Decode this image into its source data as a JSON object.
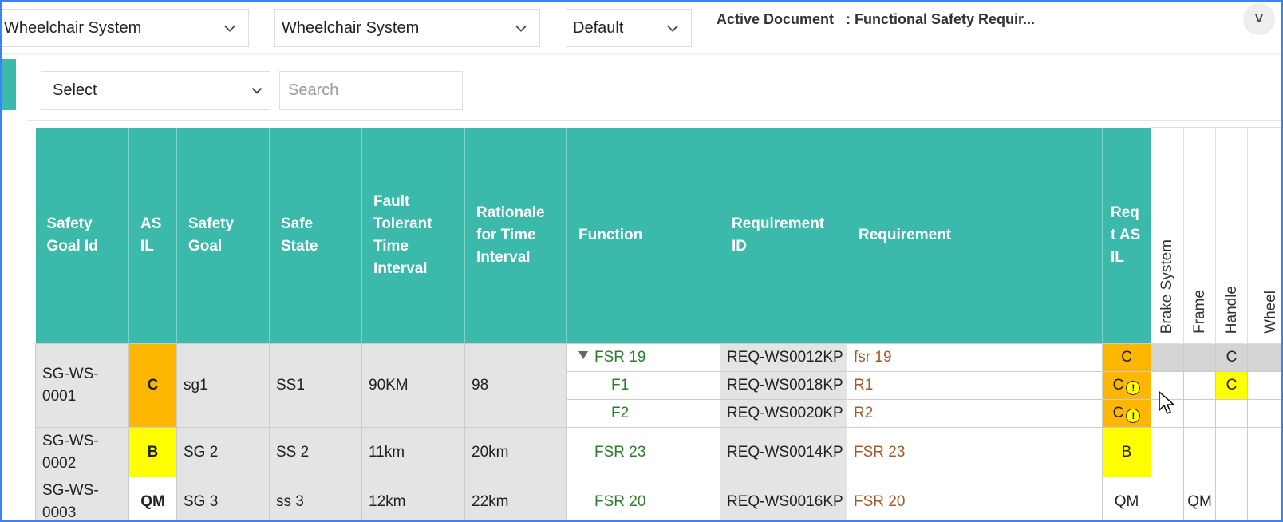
{
  "topbar": {
    "project_select_1": "Wheelchair System",
    "project_select_2": "Wheelchair System",
    "config_select": "Default",
    "active_label": "Active Document",
    "active_value": ": Functional Safety Requir...",
    "avatar_text": "V"
  },
  "filters": {
    "select_value": "Select",
    "search_placeholder": "Search"
  },
  "table": {
    "headers": {
      "sg_id": "Safety Goal Id",
      "asil": "ASIL",
      "safety_goal": "Safety Goal",
      "safe_state": "Safe State",
      "ftti": "Fault Tolerant Time Interval",
      "rationale": "Rationale for Time Interval",
      "function": "Function",
      "req_id": "Requirement ID",
      "requirement": "Requirement",
      "reqt_asil": "Reqt ASIL",
      "brake": "Brake System",
      "frame": "Frame",
      "handle": "Handle",
      "wheel": "Wheel"
    },
    "goals": [
      {
        "id": "SG-WS-0001",
        "asil": "C",
        "goal": "sg1",
        "state": "SS1",
        "ftti": "90KM",
        "rationale": "98",
        "rows": [
          {
            "function": "FSR 19",
            "req_id": "REQ-WS0012KP",
            "requirement": "fsr 19",
            "reqt_asil": "C",
            "handle": "C"
          },
          {
            "function": "F1",
            "req_id": "REQ-WS0018KP",
            "requirement": "R1",
            "reqt_asil": "C",
            "handle": "C"
          },
          {
            "function": "F2",
            "req_id": "REQ-WS0020KP",
            "requirement": "R2",
            "reqt_asil": "C"
          }
        ]
      },
      {
        "id": "SG-WS-0002",
        "asil": "B",
        "goal": "SG 2",
        "state": "SS 2",
        "ftti": "11km",
        "rationale": "20km",
        "rows": [
          {
            "function": "FSR 23",
            "req_id": "REQ-WS0014KP",
            "requirement": "FSR 23",
            "reqt_asil": "B"
          }
        ]
      },
      {
        "id": "SG-WS-0003",
        "asil": "QM",
        "goal": "SG 3",
        "state": "ss 3",
        "ftti": "12km",
        "rationale": "22km",
        "rows": [
          {
            "function": "FSR 20",
            "req_id": "REQ-WS0016KP",
            "requirement": "FSR 20",
            "reqt_asil": "QM",
            "frame": "QM"
          }
        ]
      }
    ]
  },
  "icons": {
    "chevron": "chevron-down-icon",
    "warning": "warning-icon",
    "expand": "collapse-triangle-icon",
    "cursor": "mouse-cursor-icon"
  },
  "colors": {
    "header": "#3bb9aa",
    "asil_c": "#fdb700",
    "asil_b": "#ffff00",
    "function_text": "#2c7d2c",
    "requirement_text": "#a05b2c"
  }
}
